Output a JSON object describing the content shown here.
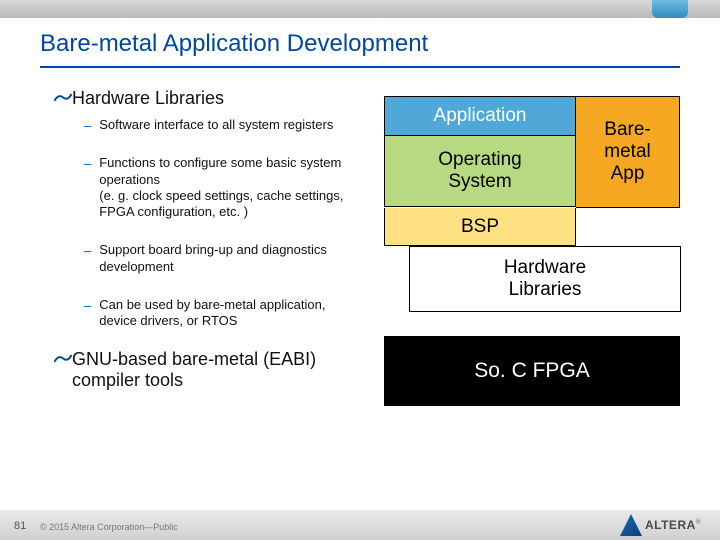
{
  "title": "Bare-metal Application Development",
  "bullets": {
    "item1": {
      "text": "Hardware Libraries"
    },
    "item1_subs": [
      "Software interface to all system registers",
      "Functions to configure some basic system operations\n(e. g. clock speed settings, cache settings, FPGA configuration, etc. )",
      "Support board bring-up and diagnostics development",
      "Can be used by bare-metal application, device drivers, or RTOS"
    ],
    "item2": {
      "text": "GNU-based bare-metal (EABI) compiler tools"
    }
  },
  "diagram": {
    "application": "Application",
    "os": "Operating\nSystem",
    "baremetal": "Bare-\nmetal\nApp",
    "bsp": "BSP",
    "hwlib": "Hardware\nLibraries",
    "soc": "So. C FPGA"
  },
  "footer": {
    "page": "81",
    "copyright": "© 2015 Altera Corporation—Public",
    "logo_text": "ALTERA"
  }
}
